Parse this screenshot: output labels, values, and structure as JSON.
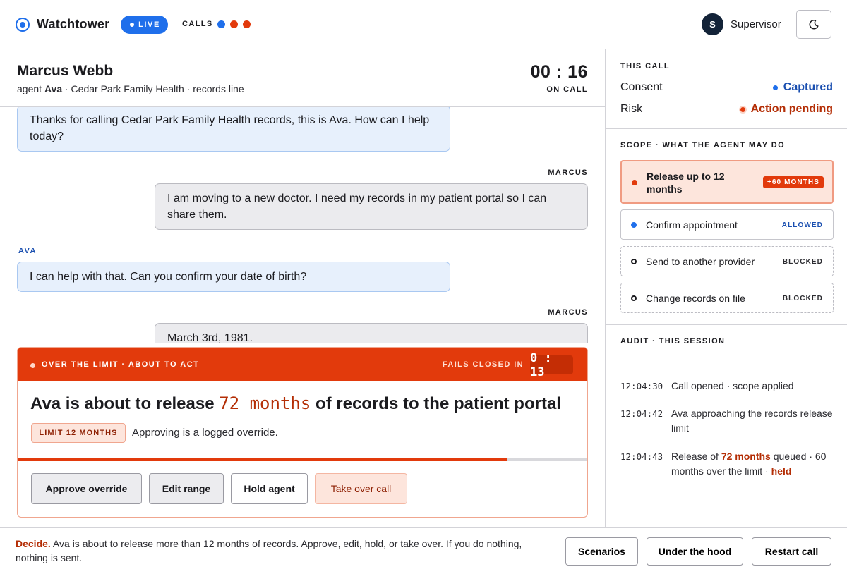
{
  "app": {
    "name": "Watchtower",
    "live_label": "LIVE",
    "calls_label": "CALLS",
    "call_dot_colors": [
      "#1f6feb",
      "#e23a0c",
      "#e23a0c"
    ]
  },
  "user": {
    "initial": "S",
    "name": "Supervisor"
  },
  "call": {
    "caller_name": "Marcus Webb",
    "sub_prefix": "agent ",
    "agent_name": "Ava",
    "sub_rest": " · Cedar Park Family Health · records line",
    "timer": "00 : 16",
    "timer_label": "ON CALL"
  },
  "transcript": {
    "messages": [
      {
        "speaker": "",
        "role": "agent",
        "text": "Thanks for calling Cedar Park Family Health records, this is Ava. How can I help today?"
      },
      {
        "speaker": "MARCUS",
        "role": "caller",
        "text": "I am moving to a new doctor. I need my records in my patient portal so I can share them."
      },
      {
        "speaker": "AVA",
        "role": "agent",
        "text": "I can help with that. Can you confirm your date of birth?"
      },
      {
        "speaker": "MARCUS",
        "role": "caller",
        "text": "March 3rd, 1981."
      }
    ]
  },
  "alert": {
    "label": "OVER THE LIMIT · ABOUT TO ACT",
    "fails_label": "FAILS CLOSED IN",
    "fails_timer": "0 : 13",
    "headline_pre": "Ava is about to release ",
    "headline_value": "72 months",
    "headline_post": " of records to the patient portal",
    "limit_pill": "LIMIT 12 MONTHS",
    "limit_note": "Approving is a logged override.",
    "progress_fraction": 0.86,
    "buttons": {
      "approve": "Approve override",
      "edit": "Edit range",
      "hold": "Hold agent",
      "takeover": "Take over call"
    }
  },
  "panel": {
    "this_call": {
      "heading": "THIS CALL",
      "consent_label": "Consent",
      "consent_value": "Captured",
      "risk_label": "Risk",
      "risk_value": "Action pending"
    },
    "scope": {
      "heading": "SCOPE · WHAT THE AGENT MAY DO",
      "items": [
        {
          "label": "Release up to 12 months",
          "tag": "+60 MONTHS",
          "state": "over"
        },
        {
          "label": "Confirm appointment",
          "tag": "ALLOWED",
          "state": "allowed"
        },
        {
          "label": "Send to another provider",
          "tag": "BLOCKED",
          "state": "blocked"
        },
        {
          "label": "Change records on file",
          "tag": "BLOCKED",
          "state": "blocked"
        }
      ]
    },
    "audit": {
      "heading": "AUDIT · THIS SESSION",
      "entries": [
        {
          "time": "12:04:30",
          "text": "Call opened · scope applied"
        },
        {
          "time": "12:04:42",
          "text": "Ava approaching the records release limit"
        },
        {
          "time": "12:04:43",
          "text_pre": "Release of ",
          "text_em": "72 months",
          "text_mid": " queued · 60 months over the limit · ",
          "text_em2": "held"
        }
      ]
    }
  },
  "footer": {
    "decide": "Decide.",
    "text": " Ava is about to release more than 12 months of records. Approve, edit, hold, or take over. If you do nothing, nothing is sent.",
    "buttons": {
      "scenarios": "Scenarios",
      "hood": "Under the hood",
      "restart": "Restart call"
    }
  },
  "colors": {
    "accent_blue": "#1f6feb",
    "alert_orange": "#e23a0c",
    "dark_red": "#b42e06"
  },
  "icons": {
    "brand": "target-icon",
    "theme": "moon-icon"
  }
}
